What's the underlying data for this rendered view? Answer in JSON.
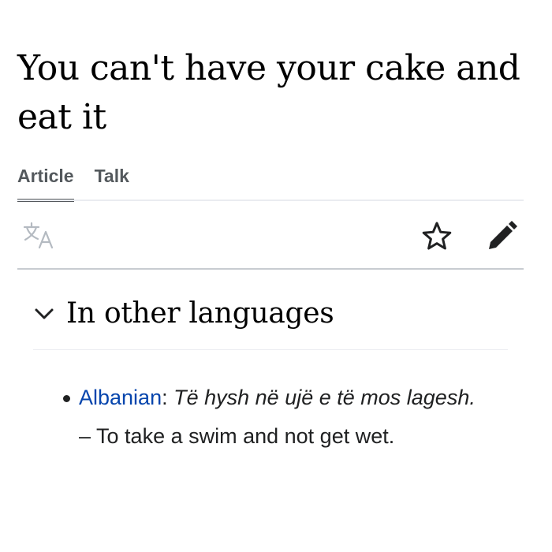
{
  "page": {
    "title": "You can't have your cake and eat it"
  },
  "tabs": [
    {
      "label": "Article",
      "active": true
    },
    {
      "label": "Talk",
      "active": false
    }
  ],
  "toolbar": {
    "icons": [
      "language-translate-icon",
      "watch-star-icon",
      "edit-pencil-icon"
    ]
  },
  "section": {
    "title": "In other languages",
    "expanded": true,
    "icon": "chevron-down-icon"
  },
  "entries": [
    {
      "language": "Albanian",
      "separator": ":",
      "phrase": "Të hysh në ujë e të mos lagesh.",
      "dash": " – ",
      "translation": "To take a swim and not get wet."
    }
  ],
  "colors": {
    "link": "#0645ad",
    "text": "#202122",
    "tab_text": "#54595d",
    "icon_muted": "#a2a9b1",
    "icon_dark": "#202122",
    "rule": "#c8ccd1"
  }
}
